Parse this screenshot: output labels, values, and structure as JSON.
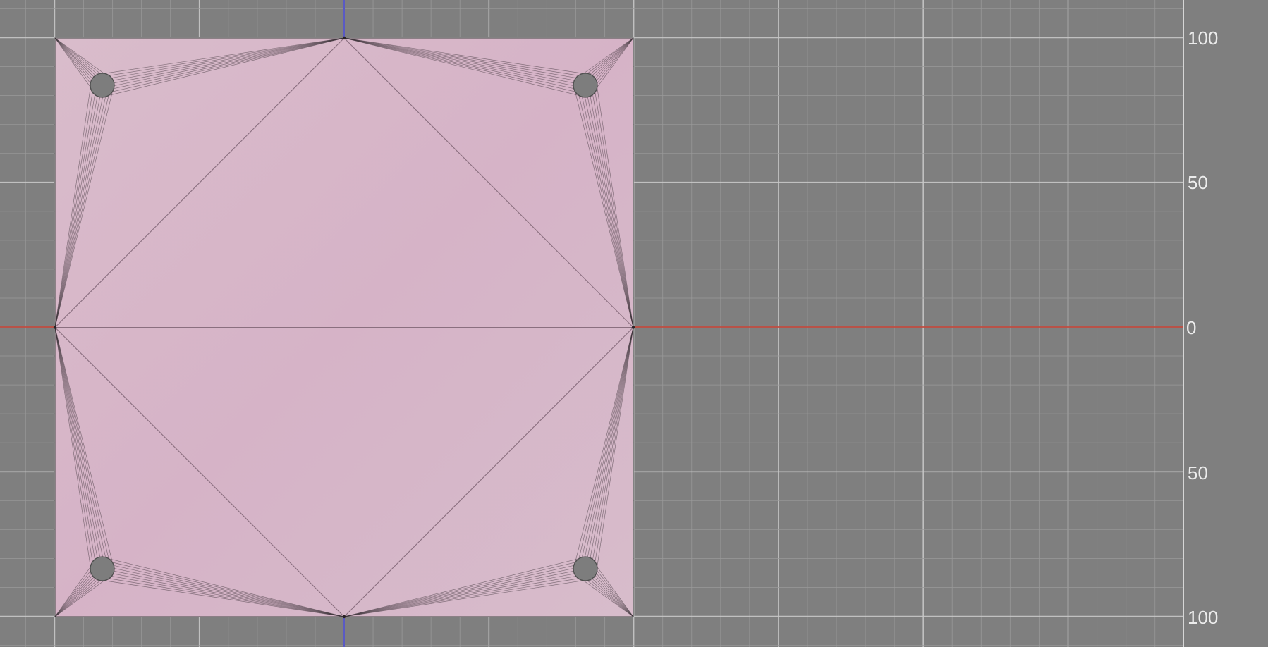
{
  "canvas": {
    "background_color": "#7f7f7f",
    "grid_minor_color": "#9a9a9a",
    "grid_major_color": "#c8c8c8",
    "x_axis_color": "#c0392b",
    "y_axis_color": "#3a3ad0",
    "sheet_fill_color": "#d8b6c8",
    "crease_color": "#3b3238",
    "joint_fill_color": "#7d7d7d"
  },
  "ruler": {
    "labels": [
      {
        "value": "100"
      },
      {
        "value": "50"
      },
      {
        "value": "0"
      },
      {
        "value": "50"
      },
      {
        "value": "100"
      }
    ]
  },
  "model": {
    "joint_count": 4,
    "fan_lines_per_bundle": 9
  }
}
